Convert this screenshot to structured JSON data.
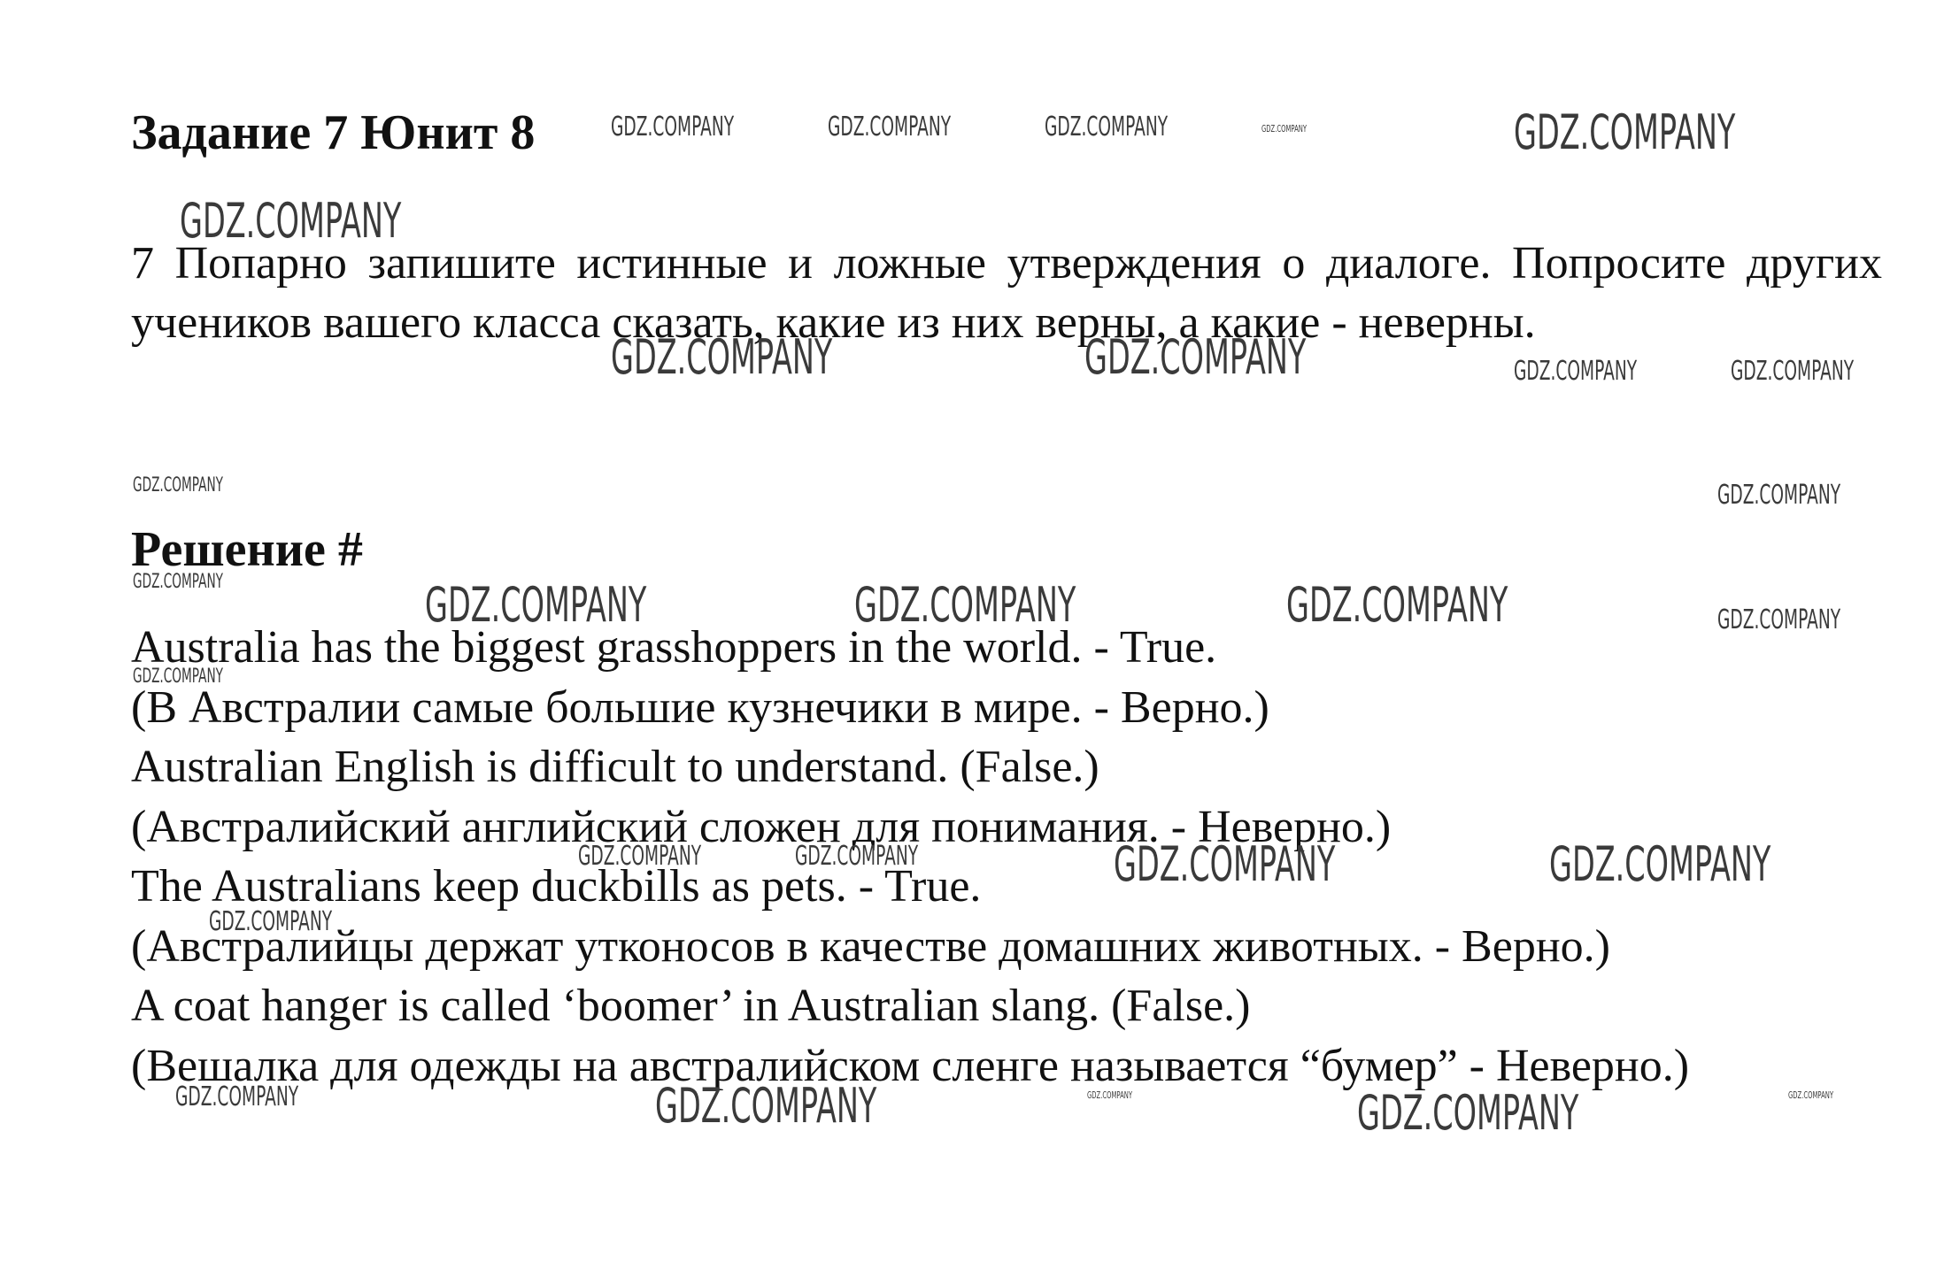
{
  "header": {
    "title": "Задание 7 Юнит 8"
  },
  "task": {
    "text": "7 Попарно запишите истинные и ложные утверждения о диалоге. Попросите других учеников вашего класса сказать, какие из них верны, а какие - неверны."
  },
  "solution": {
    "title": "Решение #",
    "lines": [
      "Australia has the biggest grasshoppers in the world. - True.",
      "(В Австралии самые большие кузнечики в мире. - Верно.)",
      "Australian English is difficult to understand. (False.)",
      "(Австралийский английский сложен для понимания. - Неверно.)",
      "The Australians keep duckbills as pets. - True.",
      "(Австралийцы держат утконосов в качестве домашних животных. - Верно.)",
      "A coat hanger is called ‘boomer’ in Australian slang. (False.)",
      "(Вешалка для одежды на австралийском сленге называется “бумер” - Неверно.)"
    ]
  },
  "watermark": {
    "text": "GDZ.COMPANY"
  }
}
